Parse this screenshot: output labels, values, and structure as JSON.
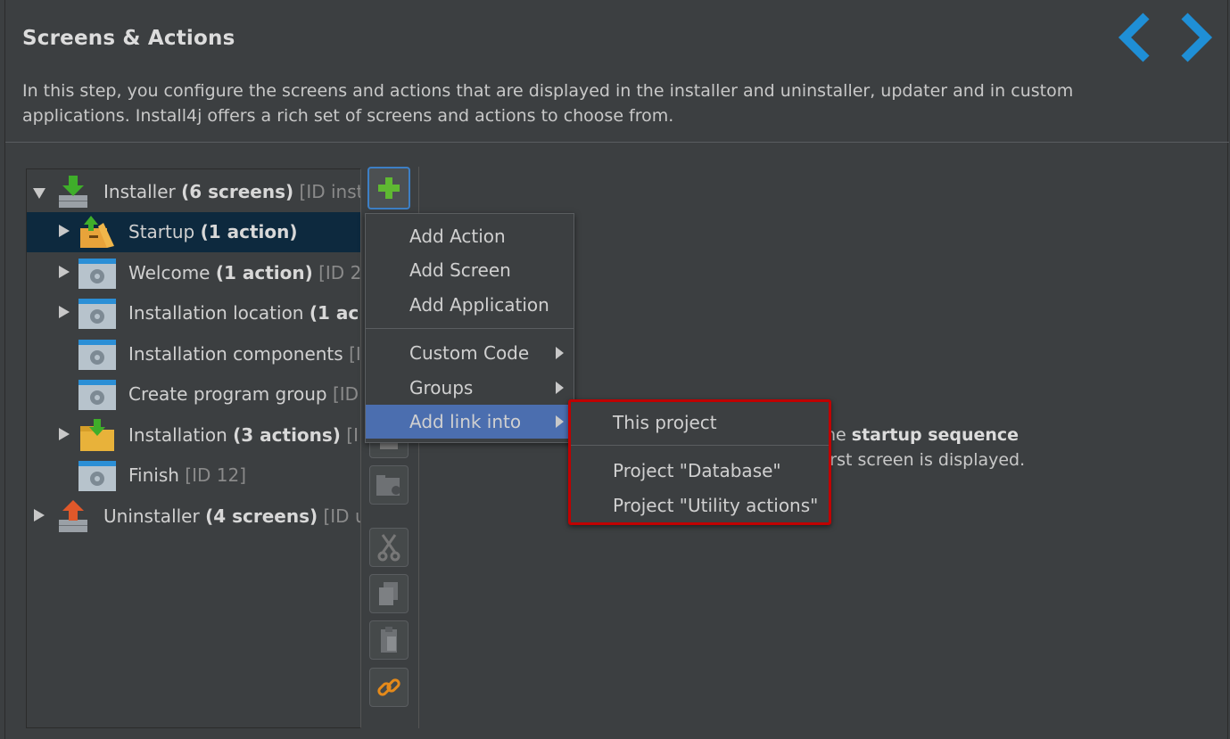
{
  "page": {
    "title": "Screens & Actions",
    "description": "In this step, you configure the screens and actions that are displayed in the installer and uninstaller, updater and in custom applications. Install4j offers a rich set of screens and actions to choose from."
  },
  "tree": {
    "installer": {
      "label": "Installer ",
      "bold": "(6 screens)",
      "muted": " [ID instal..."
    },
    "items": [
      {
        "label": "Startup ",
        "bold": "(1 action)",
        "muted": ""
      },
      {
        "label": "Welcome ",
        "bold": "(1 action)",
        "muted": " [ID 2]"
      },
      {
        "label": "Installation location ",
        "bold": "(1 ac...",
        "muted": ""
      },
      {
        "label": "Installation components ",
        "bold": "",
        "muted": "[I..."
      },
      {
        "label": "Create program group ",
        "bold": "",
        "muted": "[ID..."
      },
      {
        "label": "Installation ",
        "bold": "(3 actions)",
        "muted": " [I..."
      },
      {
        "label": "Finish ",
        "bold": "",
        "muted": "[ID 12]"
      }
    ],
    "uninstaller": {
      "label": "Uninstaller ",
      "bold": "(4 screens)",
      "muted": " [ID un..."
    }
  },
  "menu": {
    "add_action": "Add Action",
    "add_screen": "Add Screen",
    "add_application": "Add Application",
    "custom_code": "Custom Code",
    "groups": "Groups",
    "add_link_into": "Add link into"
  },
  "submenu": {
    "this_project": "This project",
    "project_database": "Project \"Database\"",
    "project_utility": "Project \"Utility actions\""
  },
  "info": {
    "line1_pre": "he ",
    "line1_bold": "startup sequence",
    "line2": "irst screen is displayed."
  },
  "colors": {
    "background": "#3c3f41",
    "selection": "#0d293e",
    "menu_highlight": "#4b6eaf",
    "accent_blue": "#1f8fd6",
    "highlight_border": "#c00000"
  }
}
